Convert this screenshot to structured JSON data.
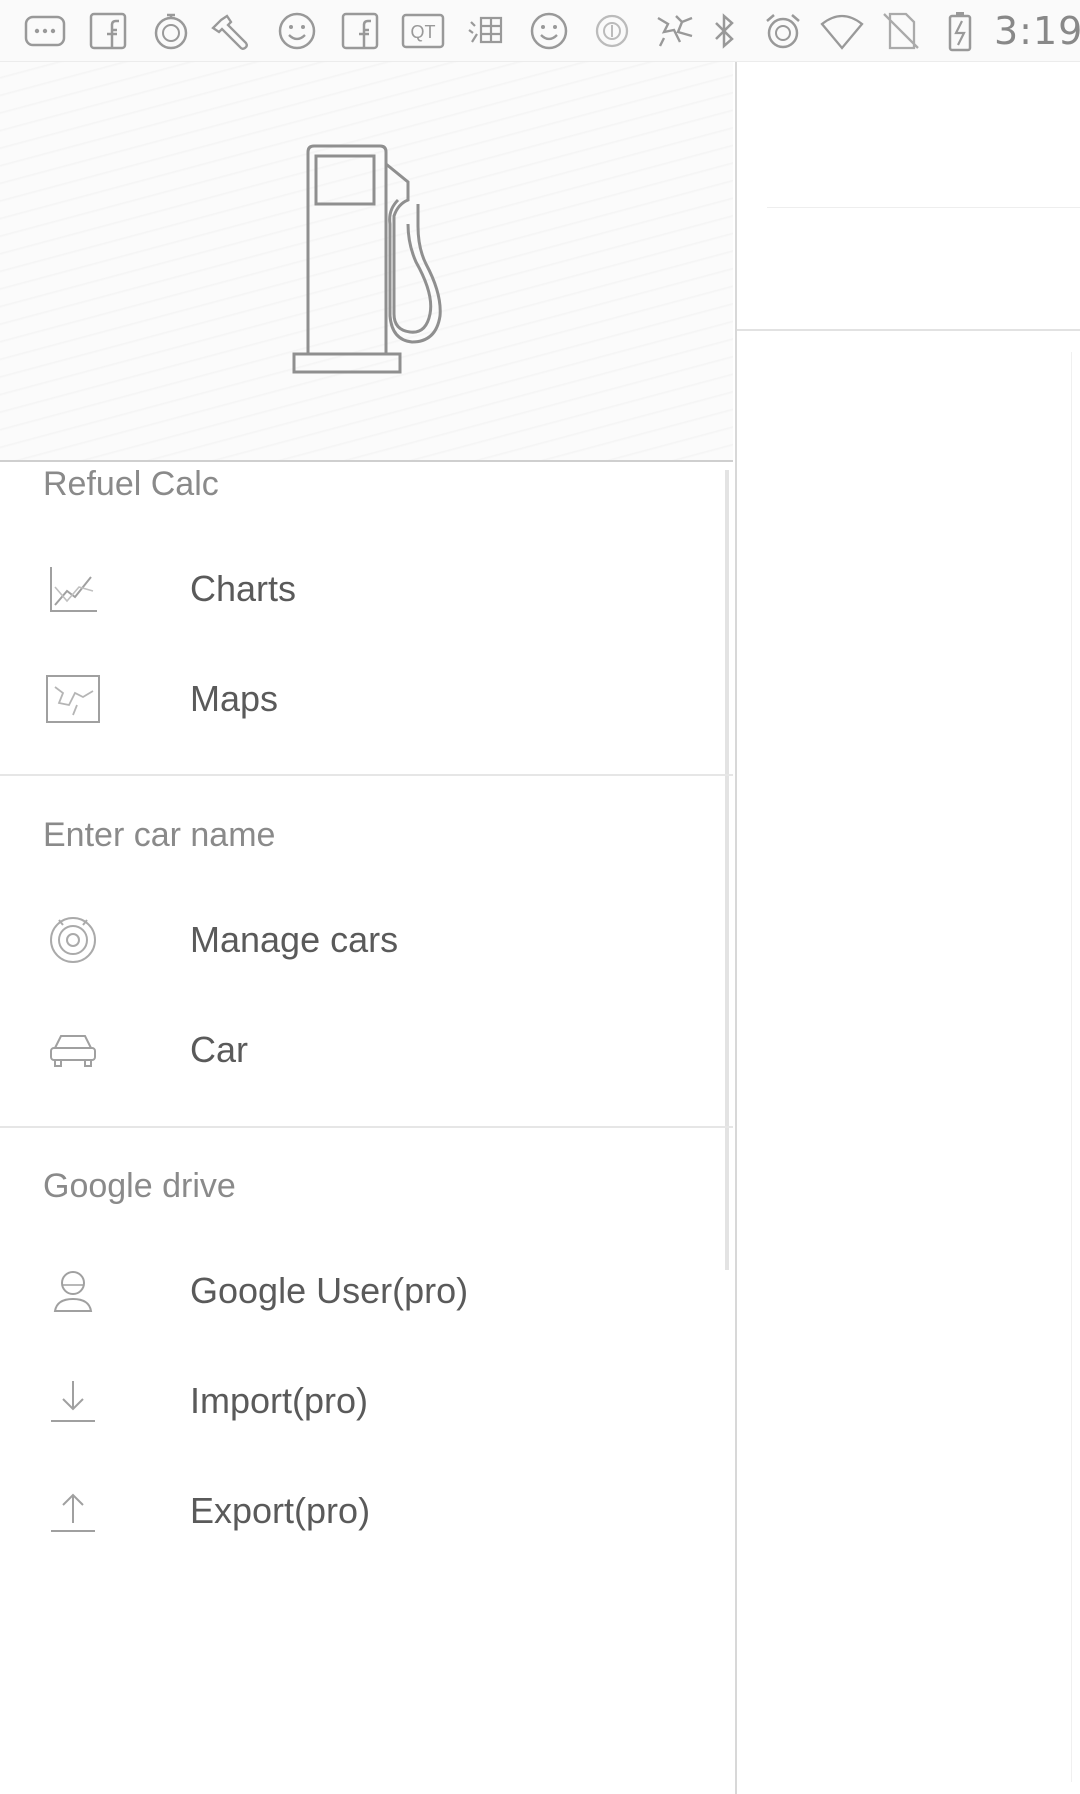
{
  "status_bar": {
    "time": "3:19",
    "notification_icons": [
      "more-icon",
      "facebook-icon",
      "stopwatch-icon",
      "wrench-icon",
      "smiley-icon",
      "facebook-icon",
      "qt-icon",
      "taobao-icon",
      "smiley-icon",
      "coin-icon",
      "sports-icon"
    ],
    "system_icons": [
      "bluetooth-icon",
      "alarm-icon",
      "wifi-icon",
      "no-sim-icon",
      "battery-charging-icon"
    ],
    "qt_label": "QT"
  },
  "drawer": {
    "header_icon": "fuel-pump-icon",
    "sections": [
      {
        "title": "Refuel Calc",
        "items": [
          {
            "label": "Charts",
            "icon": "chart-icon"
          },
          {
            "label": "Maps",
            "icon": "map-icon"
          }
        ]
      },
      {
        "title": "Enter car name",
        "items": [
          {
            "label": "Manage cars",
            "icon": "target-icon"
          },
          {
            "label": "Car",
            "icon": "car-icon"
          }
        ]
      },
      {
        "title": "Google drive",
        "items": [
          {
            "label": "Google User(pro)",
            "icon": "user-icon"
          },
          {
            "label": "Import(pro)",
            "icon": "download-icon"
          },
          {
            "label": "Export(pro)",
            "icon": "upload-icon"
          }
        ]
      }
    ]
  },
  "colors": {
    "text": "#5a5a5a",
    "subheader": "#8a8a8a",
    "divider": "#e6e6e6",
    "icon_stroke": "#9a9a9a"
  }
}
